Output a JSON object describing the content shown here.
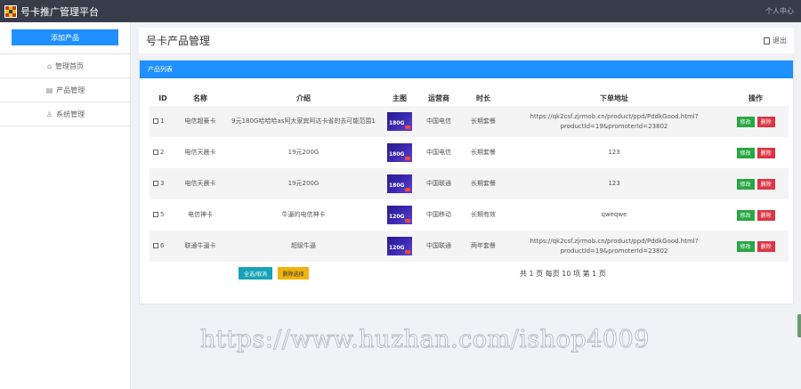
{
  "topbar": {
    "title": "号卡推广管理平台",
    "user_center": "个人中心"
  },
  "sidebar": {
    "add_button": "添加产品",
    "items": [
      {
        "icon": "home-icon",
        "label": "管理首页"
      },
      {
        "icon": "document-icon",
        "label": "产品管理"
      },
      {
        "icon": "user-icon",
        "label": "系统管理"
      }
    ]
  },
  "header": {
    "title": "号卡产品管理",
    "logout": "退出"
  },
  "panel": {
    "title": "产品列表"
  },
  "table": {
    "columns": [
      "ID",
      "名称",
      "介绍",
      "主图",
      "运营商",
      "时长",
      "下单地址",
      "操作"
    ],
    "rows": [
      {
        "id": "1",
        "name": "电信超豪卡",
        "intro": "9元180G哈哈哈as阿大家宾阿达卡省的去可能范围1",
        "thumb": "180G",
        "carrier": "中国电信",
        "duration": "长期套餐",
        "url": "https://qk2csf.zjrmob.cn/product/ppd/PddkGood.html?productId=19&promoterId=23802"
      },
      {
        "id": "2",
        "name": "电信天晨卡",
        "intro": "19元200G",
        "thumb": "180G",
        "carrier": "中国电信",
        "duration": "长期套餐",
        "url": "123"
      },
      {
        "id": "3",
        "name": "电信天晨卡",
        "intro": "19元200G",
        "thumb": "180G",
        "carrier": "中国联通",
        "duration": "长期套餐",
        "url": "123"
      },
      {
        "id": "5",
        "name": "电信神卡",
        "intro": "牛逼的电信神卡",
        "thumb": "120G",
        "carrier": "中国移动",
        "duration": "长期有效",
        "url": "qweqwe"
      },
      {
        "id": "6",
        "name": "联通牛逼卡",
        "intro": "超级牛逼",
        "thumb": "120G",
        "carrier": "中国联通",
        "duration": "两年套餐",
        "url": "https://qk2csf.zjrmob.cn/product/ppd/PddkGood.html?productId=19&promoterId=23802"
      }
    ],
    "edit_label": "修改",
    "delete_label": "删除"
  },
  "footer": {
    "select_all": "全选/取消",
    "delete_selected": "删除选择",
    "page_info": "共 1 页  每页 10 项  第 1 页"
  },
  "watermark": "https://www.huzhan.com/ishop4009",
  "colors": {
    "topbar": "#393d49",
    "primary": "#1e90ff",
    "edit": "#28a745",
    "delete": "#dc3545"
  }
}
